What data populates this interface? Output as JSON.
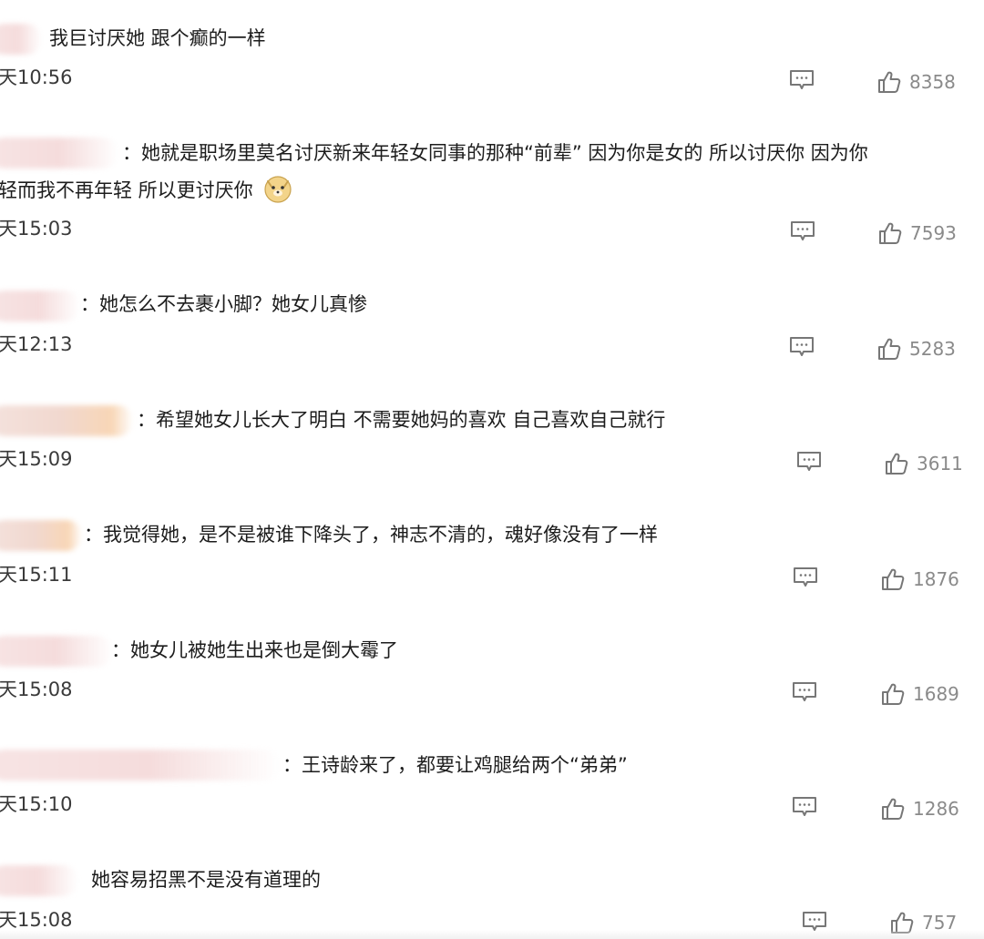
{
  "comments": [
    {
      "text": "我巨讨厌她 跟个癫的一样",
      "time": "天10:56",
      "likes": "8358"
    },
    {
      "text_line1": "：她就是职场里莫名讨厌新来年轻女同事的那种“前辈” 因为你是女的 所以讨厌你 因为你",
      "text_line2": "轻而我不再年轻 所以更讨厌你",
      "emoji": "doge-emoji",
      "time": "天15:03",
      "likes": "7593"
    },
    {
      "text": "：她怎么不去裹小脚？她女儿真惨",
      "time": "天12:13",
      "likes": "5283"
    },
    {
      "text": "：希望她女儿长大了明白 不需要她妈的喜欢 自己喜欢自己就行",
      "time": "天15:09",
      "likes": "3611"
    },
    {
      "text": "：我觉得她，是不是被谁下降头了，神志不清的，魂好像没有了一样",
      "time": "天15:11",
      "likes": "1876"
    },
    {
      "text": "：她女儿被她生出来也是倒大霉了",
      "time": "天15:08",
      "likes": "1689"
    },
    {
      "text": "：王诗龄来了，都要让鸡腿给两个“弟弟”",
      "time": "天15:10",
      "likes": "1286"
    },
    {
      "text": "她容易招黑不是没有道理的",
      "time": "天15:08",
      "likes": "757"
    }
  ],
  "icons": {
    "comment": "comment-icon",
    "like": "thumbs-up-icon"
  },
  "colors": {
    "text": "#1c1c1c",
    "meta": "#8a8a8a",
    "blur": "#f5dcdc"
  }
}
